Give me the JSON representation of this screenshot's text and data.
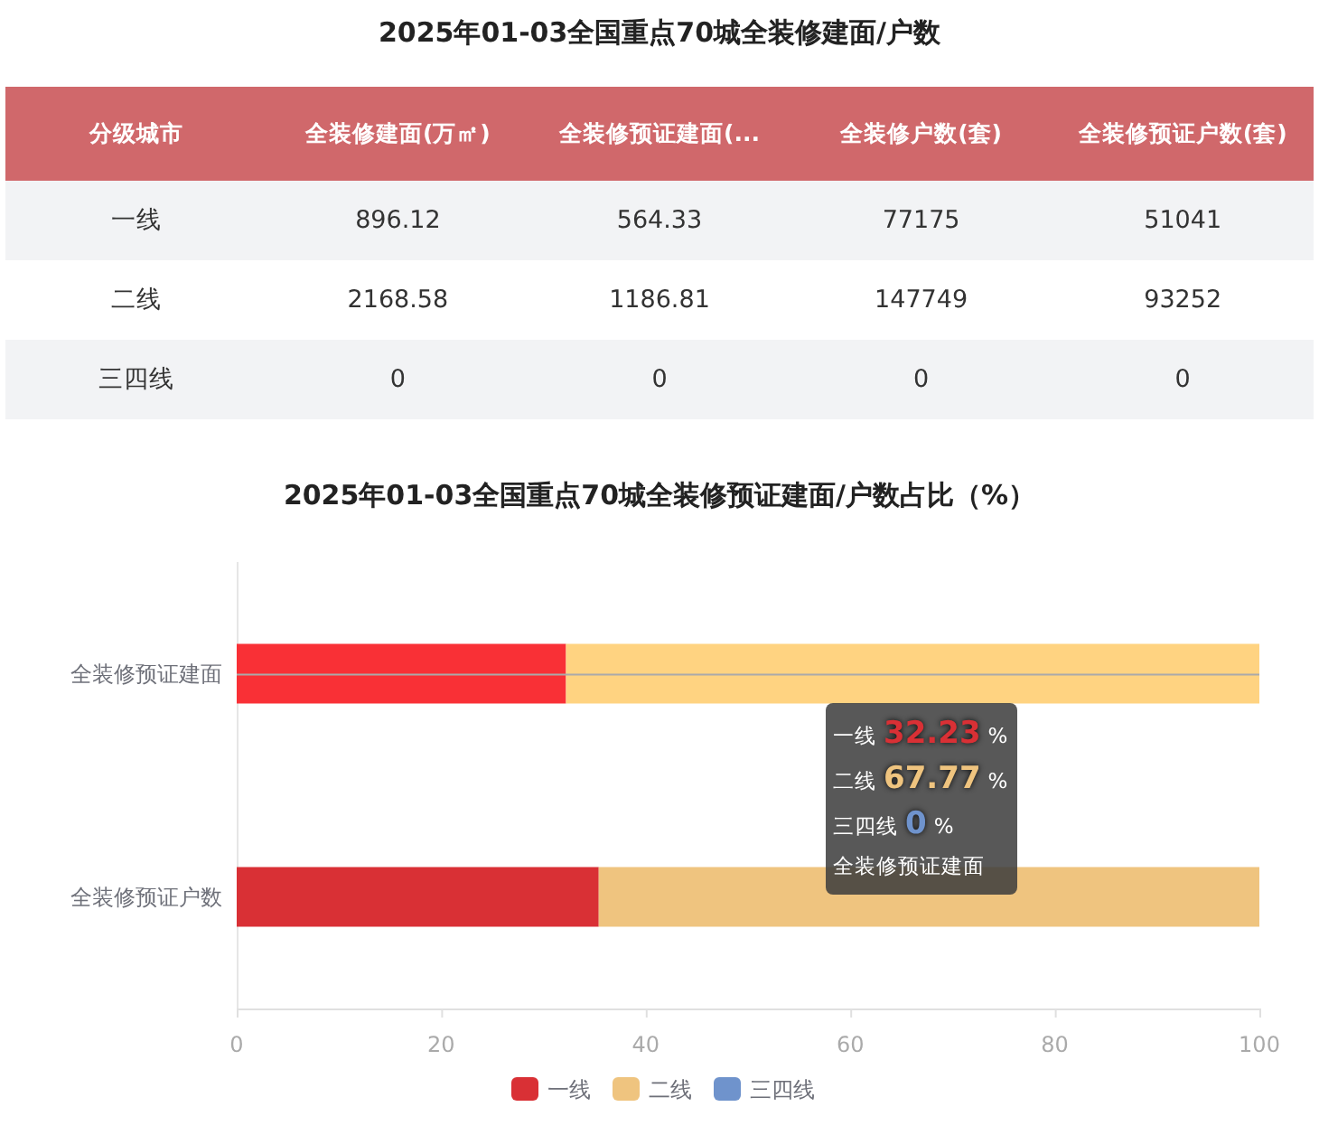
{
  "table": {
    "title": "2025年01-03全国重点70城全装修建面/户数",
    "columns": [
      "分级城市",
      "全装修建面(万㎡)",
      "全装修预证建面(...",
      "全装修户数(套)",
      "全装修预证户数(套)"
    ],
    "rows": [
      [
        "一线",
        "896.12",
        "564.33",
        "77175",
        "51041"
      ],
      [
        "二线",
        "2168.58",
        "1186.81",
        "147749",
        "93252"
      ],
      [
        "三四线",
        "0",
        "0",
        "0",
        "0"
      ]
    ]
  },
  "chart": {
    "chart_data": {
      "type": "bar",
      "orientation": "horizontal",
      "stacked": true,
      "title": "2025年01-03全国重点70城全装修预证建面/户数占比（%）",
      "categories": [
        "全装修预证建面",
        "全装修预证户数"
      ],
      "series": [
        {
          "name": "一线",
          "color": "#d93035",
          "values": [
            32.2,
            35.4
          ]
        },
        {
          "name": "二线",
          "color": "#efc47f",
          "values": [
            67.8,
            64.6
          ]
        },
        {
          "name": "三四线",
          "color": "#6f93cc",
          "values": [
            0,
            0
          ]
        }
      ],
      "xlim": [
        0,
        100
      ],
      "xticks": [
        0,
        20,
        40,
        60,
        80,
        100
      ],
      "legend": "bottom"
    },
    "category_highlight": [
      true,
      false
    ],
    "tooltip": {
      "rows": [
        {
          "label": "一线",
          "value": "32.23",
          "unit": "%",
          "color": "#d93035"
        },
        {
          "label": "二线",
          "value": "67.77",
          "unit": "%",
          "color": "#efc47f"
        },
        {
          "label": "三四线",
          "value": "0",
          "unit": "%",
          "color": "#6f93cc"
        }
      ],
      "category": "全装修预证建面"
    }
  }
}
